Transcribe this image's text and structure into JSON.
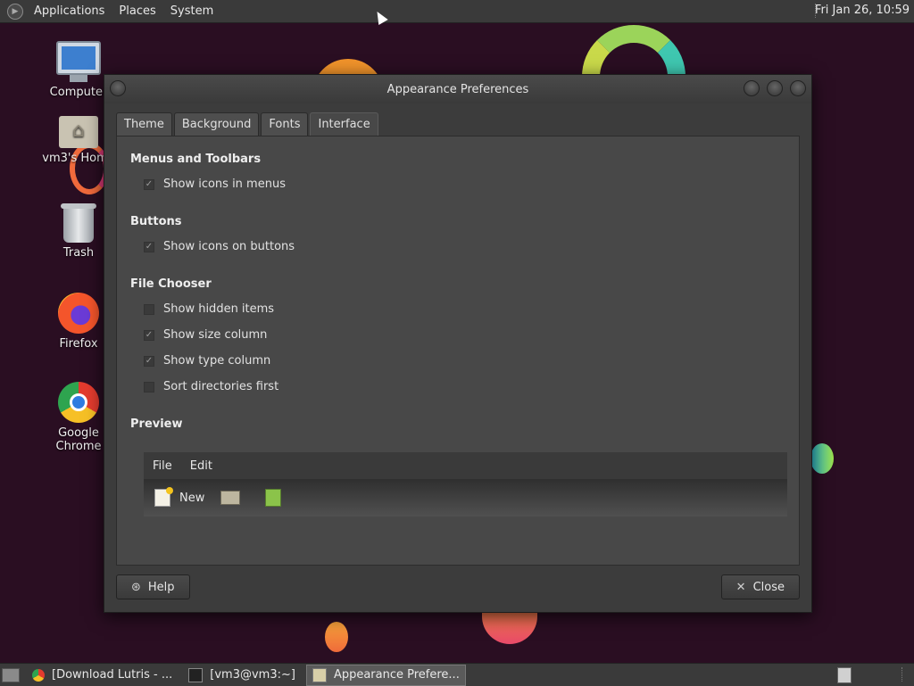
{
  "top_panel": {
    "menus": [
      "Applications",
      "Places",
      "System"
    ],
    "clock": "Fri Jan 26, 10:59"
  },
  "desktop_icons": [
    {
      "label": "Computer",
      "icon": "computer-icon"
    },
    {
      "label": "vm3's Home",
      "icon": "home-folder-icon"
    },
    {
      "label": "Trash",
      "icon": "trash-icon"
    },
    {
      "label": "Firefox",
      "icon": "firefox-icon"
    },
    {
      "label": "Google Chrome",
      "icon": "chrome-icon"
    }
  ],
  "window": {
    "title": "Appearance Preferences",
    "tabs": [
      "Theme",
      "Background",
      "Fonts",
      "Interface"
    ],
    "active_tab": "Interface",
    "sections": {
      "menus_toolbars": "Menus and Toolbars",
      "buttons": "Buttons",
      "file_chooser": "File Chooser",
      "preview": "Preview"
    },
    "options": {
      "show_icons_menus": {
        "label": "Show icons in menus",
        "checked": true
      },
      "show_icons_buttons": {
        "label": "Show icons on buttons",
        "checked": true
      },
      "show_hidden": {
        "label": "Show hidden items",
        "checked": false
      },
      "show_size": {
        "label": "Show size column",
        "checked": true
      },
      "show_type": {
        "label": "Show type column",
        "checked": true
      },
      "sort_dirs": {
        "label": "Sort directories first",
        "checked": false
      }
    },
    "preview": {
      "menus": [
        "File",
        "Edit"
      ],
      "toolbar_new": "New"
    },
    "help_label": "Help",
    "close_label": "Close"
  },
  "taskbar": {
    "tasks": [
      "[Download Lutris - ...",
      "[vm3@vm3:~]",
      "Appearance Prefere..."
    ]
  }
}
